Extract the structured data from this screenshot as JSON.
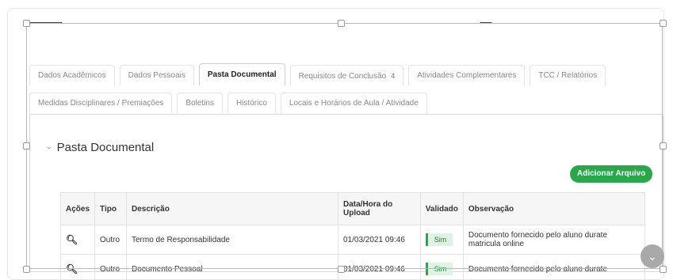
{
  "tabs_row1": [
    {
      "label": "Dados Acadêmicos",
      "count": ""
    },
    {
      "label": "Dados Pessoais",
      "count": ""
    },
    {
      "label": "Pasta Documental",
      "count": ""
    },
    {
      "label": "Requisitos de Conclusão",
      "count": "4"
    },
    {
      "label": "Atividades Complementares",
      "count": ""
    },
    {
      "label": "TCC / Relatórios",
      "count": ""
    }
  ],
  "tabs_row2": [
    {
      "label": "Medidas Disciplinares / Premiações"
    },
    {
      "label": "Boletins"
    },
    {
      "label": "Histórico"
    },
    {
      "label": "Locais e Horários de Aula / Atividade"
    }
  ],
  "section": {
    "title": "Pasta Documental"
  },
  "add_button": "Adicionar Arquivo",
  "table": {
    "headers": [
      "Ações",
      "Tipo",
      "Descrição",
      "Data/Hora do Upload",
      "Validado",
      "Observação"
    ],
    "rows": [
      {
        "tipo": "Outro",
        "descricao": "Termo de Responsabilidade",
        "data": "01/03/2021 09:46",
        "validado": "Sim",
        "observacao": "Documento fornecido pelo aluno durate matricula online"
      },
      {
        "tipo": "Outro",
        "descricao": "Documento Pessoal",
        "data": "01/03/2021 09:46",
        "validado": "Sim",
        "observacao": "Documento fornecido pelo aluno durate"
      }
    ]
  },
  "icons": {
    "action": "search-icon",
    "collapse": "chevron-icon",
    "scroll": "chevron-down-icon"
  }
}
